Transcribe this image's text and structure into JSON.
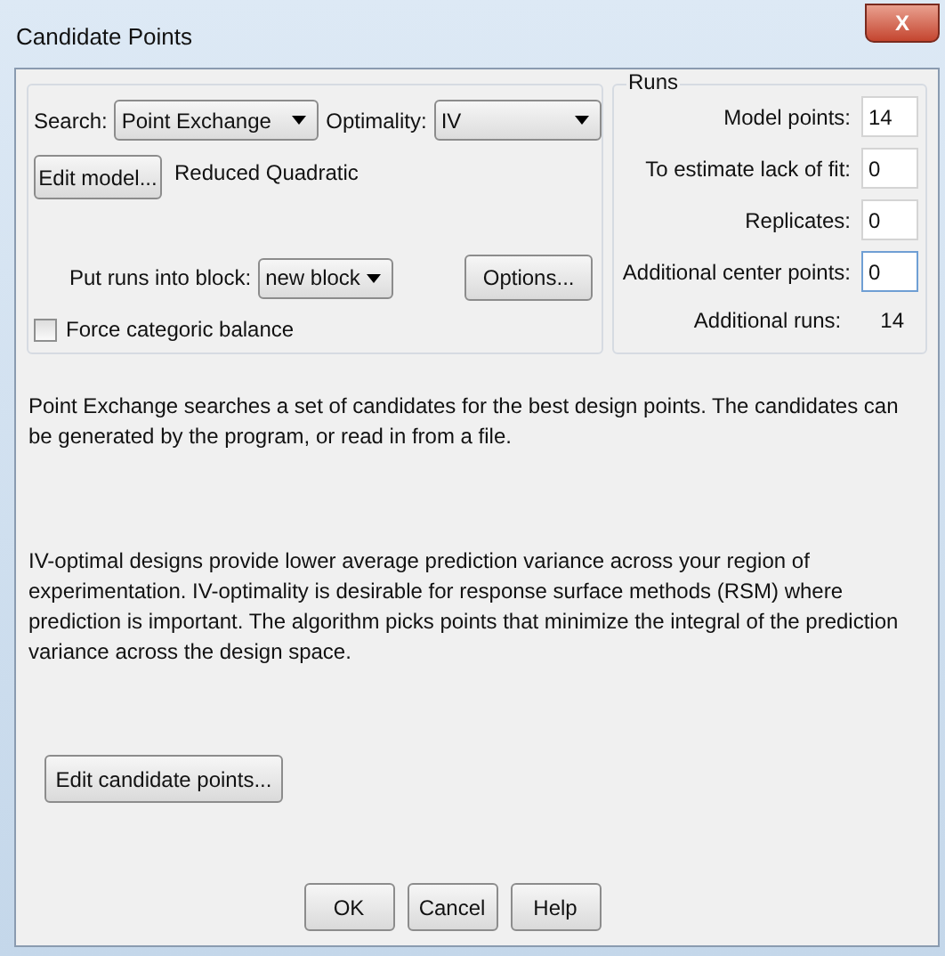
{
  "window": {
    "title": "Candidate Points",
    "close": "X"
  },
  "search": {
    "label": "Search:",
    "value": "Point Exchange"
  },
  "optimality": {
    "label": "Optimality:",
    "value": "IV"
  },
  "edit_model_button": "Edit model...",
  "model_name": "Reduced Quadratic",
  "block": {
    "label": "Put runs into block:",
    "value": "new block"
  },
  "options_button": "Options...",
  "force_balance": {
    "label": "Force categoric balance",
    "checked": false
  },
  "runs": {
    "title": "Runs",
    "fields": [
      {
        "label": "Model points:",
        "value": "14",
        "focused": false
      },
      {
        "label": "To estimate lack of fit:",
        "value": "0",
        "focused": false
      },
      {
        "label": "Replicates:",
        "value": "0",
        "focused": false
      },
      {
        "label": "Additional center points:",
        "value": "0",
        "focused": true
      }
    ],
    "additional_runs": {
      "label": "Additional runs:",
      "value": "14"
    }
  },
  "descriptions": [
    "Point Exchange searches a set of candidates for the best design points. The candidates can be generated by the program, or read in from a file.",
    "IV-optimal designs provide lower average prediction variance across your region of experimentation.  IV-optimality is desirable for response surface methods (RSM) where prediction is important.  The algorithm picks points that minimize the integral of the prediction variance across the design space."
  ],
  "edit_candidates_button": "Edit candidate points...",
  "buttons": [
    "OK",
    "Cancel",
    "Help"
  ]
}
